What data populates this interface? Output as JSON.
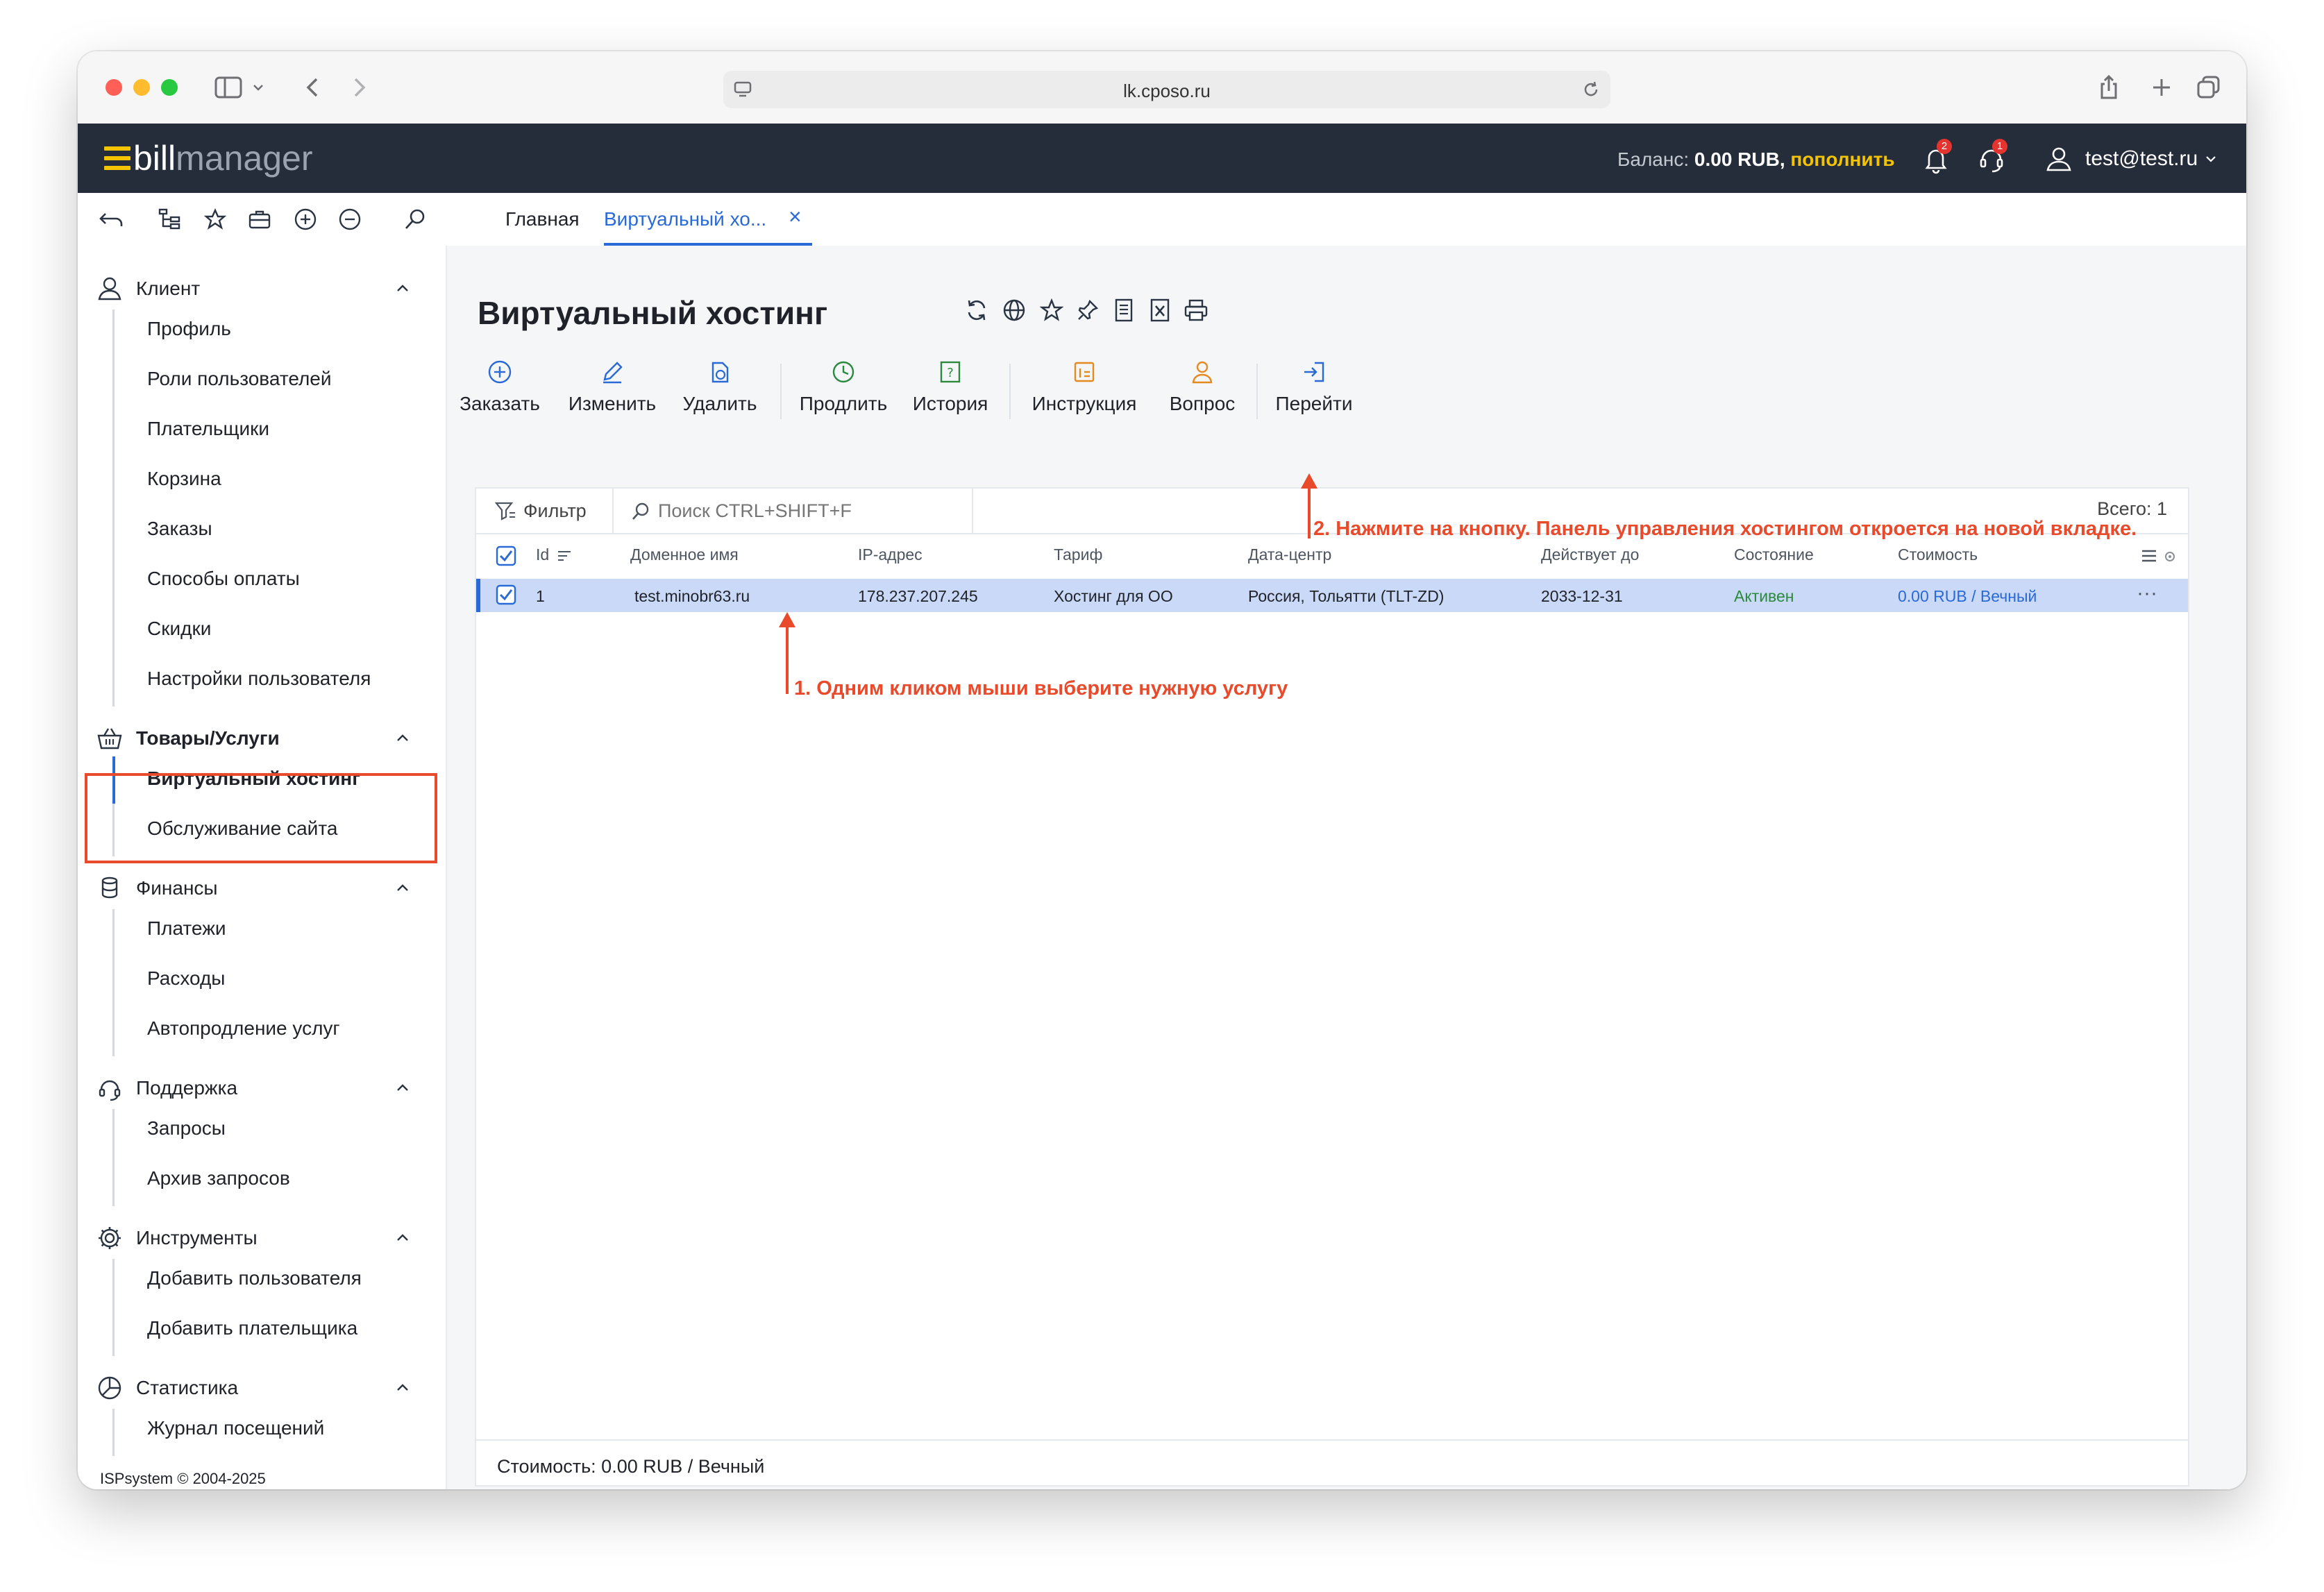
{
  "browser": {
    "url": "lk.cposo.ru"
  },
  "header": {
    "logo_bill": "bill",
    "logo_manager": "manager",
    "balance_label": "Баланс:",
    "balance_value": "0.00 RUB,",
    "topup_label": "пополнить",
    "notifications_count": "2",
    "support_count": "1",
    "user": "test@test.ru"
  },
  "tabs": {
    "main": "Главная",
    "current": "Виртуальный хо...",
    "close": "×"
  },
  "sidebar": {
    "sections": [
      {
        "title": "Клиент",
        "icon": "user-icon",
        "items": [
          "Профиль",
          "Роли пользователей",
          "Плательщики",
          "Корзина",
          "Заказы",
          "Способы оплаты",
          "Скидки",
          "Настройки пользователя"
        ]
      },
      {
        "title": "Товары/Услуги",
        "icon": "basket-icon",
        "items": [
          "Виртуальный хостинг",
          "Обслуживание сайта"
        ]
      },
      {
        "title": "Финансы",
        "icon": "coins-icon",
        "items": [
          "Платежи",
          "Расходы",
          "Автопродление услуг"
        ]
      },
      {
        "title": "Поддержка",
        "icon": "headset-icon",
        "items": [
          "Запросы",
          "Архив запросов"
        ]
      },
      {
        "title": "Инструменты",
        "icon": "gear-icon",
        "items": [
          "Добавить пользователя",
          "Добавить плательщика"
        ]
      },
      {
        "title": "Статистика",
        "icon": "pie-chart-icon",
        "items": [
          "Журнал посещений"
        ]
      }
    ],
    "copyright": "ISPsystem © 2004-2025"
  },
  "page": {
    "title": "Виртуальный хостинг"
  },
  "actions": {
    "order": "Заказать",
    "edit": "Изменить",
    "delete": "Удалить",
    "prolong": "Продлить",
    "history": "История",
    "instruction": "Инструкция",
    "question": "Вопрос",
    "goto": "Перейти"
  },
  "list": {
    "filter_label": "Фильтр",
    "search_placeholder": "Поиск CTRL+SHIFT+F",
    "total": "Всего: 1",
    "columns": [
      "Id",
      "Доменное имя",
      "IP-адрес",
      "Тариф",
      "Дата-центр",
      "Действует до",
      "Состояние",
      "Стоимость"
    ],
    "rows": [
      {
        "id": "1",
        "domain": "test.minobr63.ru",
        "ip": "178.237.207.245",
        "tariff": "Хостинг для ОО",
        "datacenter": "Россия, Тольятти (TLT-ZD)",
        "expires": "2033-12-31",
        "status": "Активен",
        "cost": "0.00 RUB / Вечный",
        "more": "···"
      }
    ],
    "footer": "Стоимость: 0.00 RUB / Вечный"
  },
  "annotations": {
    "step1": "1. Одним кликом мыши выберите нужную услугу",
    "step2": "2. Нажмите на кнопку. Панель управления хостингом откроется на новой вкладке."
  },
  "colors": {
    "header_bg": "#252d3a",
    "accent": "#2a6ad6",
    "topup": "#f5c400",
    "annotation": "#e84a2b",
    "status_active": "#2b8a3e",
    "selected_row": "#c9d9f7"
  }
}
